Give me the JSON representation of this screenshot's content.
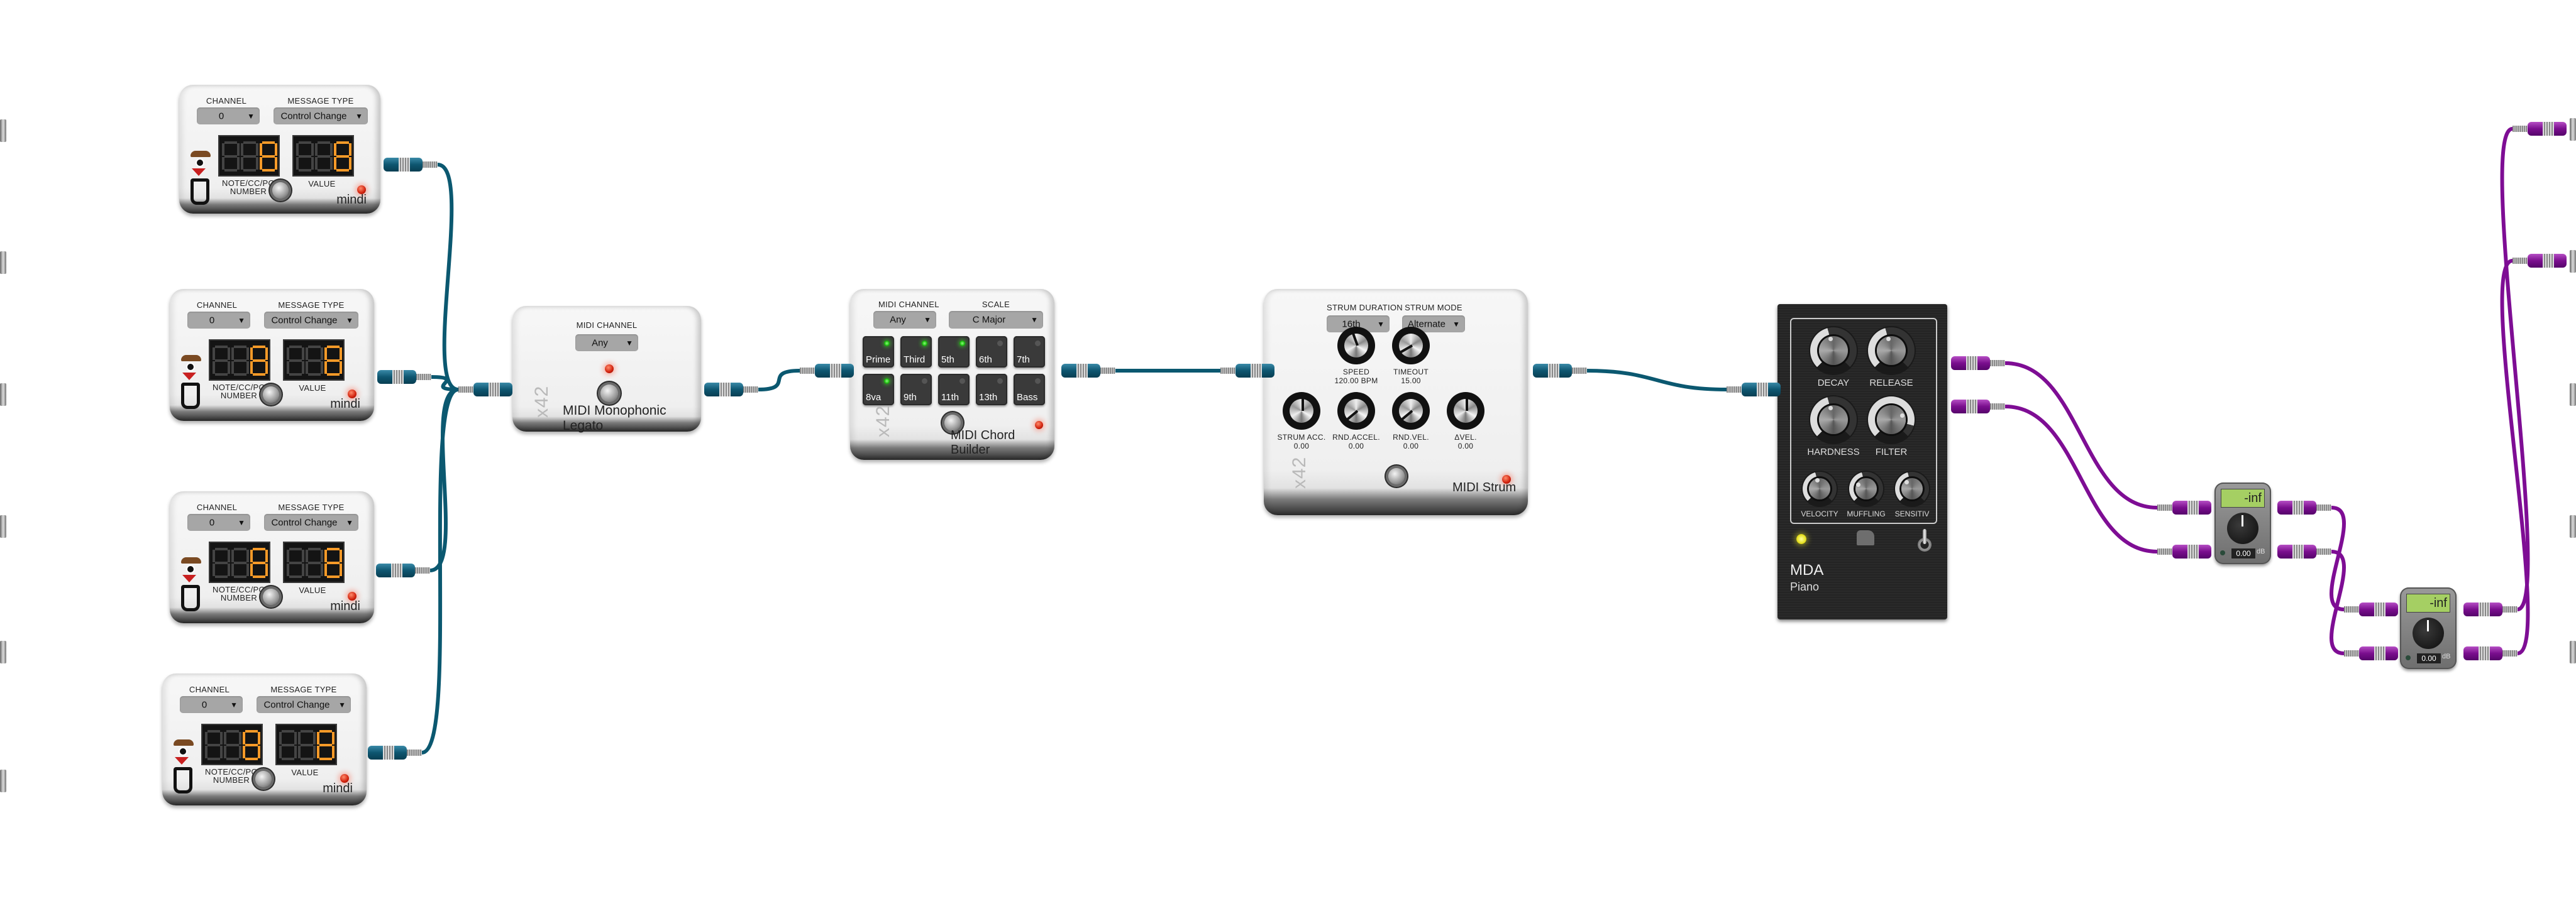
{
  "colors": {
    "midi_cable": "#0b5870",
    "audio_cable": "#7e0d94",
    "digit_on": "#f79a28",
    "led_red": "#d0200c",
    "led_green": "#18b90a",
    "led_yellow": "#f4f03a",
    "lcd_green": "#a5cf63"
  },
  "mindi_pedals": [
    {
      "channel_label": "CHANNEL",
      "channel_value": "0",
      "type_label": "MESSAGE TYPE",
      "type_value": "Control Change",
      "number_label": "NOTE/CC/PG",
      "number_label2": "NUMBER",
      "number_value": "0",
      "value_label": "VALUE",
      "value_value": "0",
      "brand": "mindi"
    },
    {
      "channel_label": "CHANNEL",
      "channel_value": "0",
      "type_label": "MESSAGE TYPE",
      "type_value": "Control Change",
      "number_label": "NOTE/CC/PG",
      "number_label2": "NUMBER",
      "number_value": "0",
      "value_label": "VALUE",
      "value_value": "0",
      "brand": "mindi"
    },
    {
      "channel_label": "CHANNEL",
      "channel_value": "0",
      "type_label": "MESSAGE TYPE",
      "type_value": "Control Change",
      "number_label": "NOTE/CC/PG",
      "number_label2": "NUMBER",
      "number_value": "0",
      "value_label": "VALUE",
      "value_value": "0",
      "brand": "mindi"
    },
    {
      "channel_label": "CHANNEL",
      "channel_value": "0",
      "type_label": "MESSAGE TYPE",
      "type_value": "Control Change",
      "number_label": "NOTE/CC/PG",
      "number_label2": "NUMBER",
      "number_value": "0",
      "value_label": "VALUE",
      "value_value": "0",
      "brand": "mindi"
    }
  ],
  "legato": {
    "channel_label": "MIDI CHANNEL",
    "channel_value": "Any",
    "maker": "x42",
    "name": "MIDI Monophonic Legato"
  },
  "chord_builder": {
    "channel_label": "MIDI CHANNEL",
    "channel_value": "Any",
    "scale_label": "SCALE",
    "scale_value": "C Major",
    "maker": "x42",
    "name": "MIDI Chord Builder",
    "pads": [
      {
        "label": "Prime",
        "on": true
      },
      {
        "label": "Third",
        "on": true
      },
      {
        "label": "5th",
        "on": true
      },
      {
        "label": "6th",
        "on": false
      },
      {
        "label": "7th",
        "on": false
      },
      {
        "label": "8va",
        "on": true
      },
      {
        "label": "9th",
        "on": false
      },
      {
        "label": "11th",
        "on": false
      },
      {
        "label": "13th",
        "on": false
      },
      {
        "label": "Bass",
        "on": false
      }
    ]
  },
  "strum": {
    "duration_label": "STRUM DURATION",
    "duration_value": "16th",
    "mode_label": "STRUM MODE",
    "mode_value": "Alternate",
    "maker": "x42",
    "name": "MIDI Strum",
    "knobs": [
      {
        "label": "SPEED",
        "value": "120.00 BPM"
      },
      {
        "label": "TIMEOUT",
        "value": "15.00"
      },
      {
        "label": "STRUM ACC.",
        "value": "0.00"
      },
      {
        "label": "RND.ACCEL.",
        "value": "0.00"
      },
      {
        "label": "RND.VEL.",
        "value": "0.00"
      },
      {
        "label": "ΔVEL.",
        "value": "0.00"
      }
    ]
  },
  "piano": {
    "maker": "MDA",
    "name": "Piano",
    "knobs": [
      {
        "label": "DECAY"
      },
      {
        "label": "RELEASE"
      },
      {
        "label": "HARDNESS"
      },
      {
        "label": "FILTER"
      },
      {
        "label": "VELOCITY"
      },
      {
        "label": "MUFFLING"
      },
      {
        "label": "SENSITIV"
      }
    ],
    "bypass_on": true
  },
  "gains": [
    {
      "lcd": "-inf",
      "value": "0.00",
      "unit": "dB"
    },
    {
      "lcd": "-inf",
      "value": "0.00",
      "unit": "dB"
    }
  ]
}
